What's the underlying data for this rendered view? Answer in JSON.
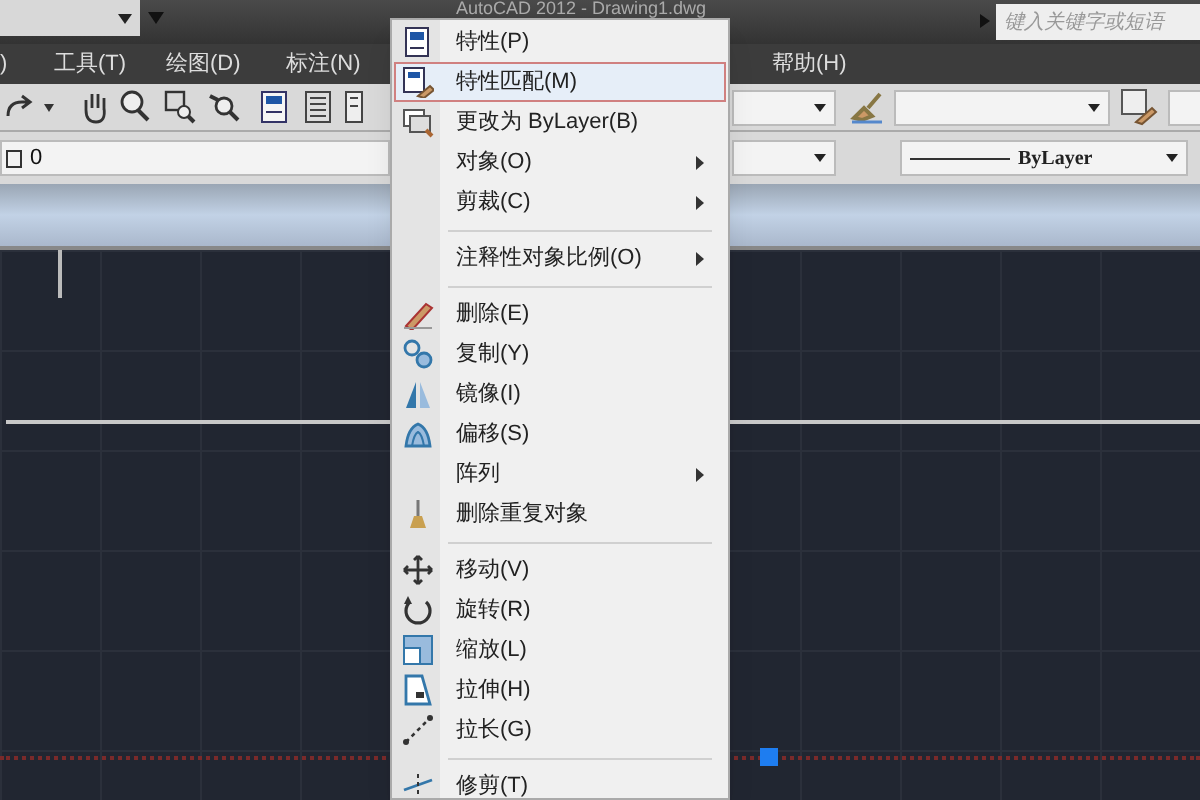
{
  "window": {
    "title": "AutoCAD 2012 - Drawing1.dwg",
    "search_placeholder": "键入关键字或短语"
  },
  "menu_bar": [
    ")",
    "工具(T)",
    "绘图(D)",
    "标注(N)",
    "帮助(H)"
  ],
  "layers_toolbar": {
    "layer": "0",
    "linetype": "ByLayer"
  },
  "context_menu": [
    {
      "kind": "item",
      "label": "特性(P)",
      "selected": false,
      "submenu": false
    },
    {
      "kind": "item",
      "label": "特性匹配(M)",
      "selected": true,
      "submenu": false
    },
    {
      "kind": "item",
      "label": "更改为 ByLayer(B)",
      "selected": false,
      "submenu": false
    },
    {
      "kind": "item",
      "label": "对象(O)",
      "selected": false,
      "submenu": true
    },
    {
      "kind": "item",
      "label": "剪裁(C)",
      "selected": false,
      "submenu": true
    },
    {
      "kind": "separator"
    },
    {
      "kind": "item",
      "label": "注释性对象比例(O)",
      "selected": false,
      "submenu": true
    },
    {
      "kind": "separator"
    },
    {
      "kind": "item",
      "label": "删除(E)",
      "selected": false,
      "submenu": false
    },
    {
      "kind": "item",
      "label": "复制(Y)",
      "selected": false,
      "submenu": false
    },
    {
      "kind": "item",
      "label": "镜像(I)",
      "selected": false,
      "submenu": false
    },
    {
      "kind": "item",
      "label": "偏移(S)",
      "selected": false,
      "submenu": false
    },
    {
      "kind": "item",
      "label": "阵列",
      "selected": false,
      "submenu": true
    },
    {
      "kind": "item",
      "label": "删除重复对象",
      "selected": false,
      "submenu": false
    },
    {
      "kind": "separator"
    },
    {
      "kind": "item",
      "label": "移动(V)",
      "selected": false,
      "submenu": false
    },
    {
      "kind": "item",
      "label": "旋转(R)",
      "selected": false,
      "submenu": false
    },
    {
      "kind": "item",
      "label": "缩放(L)",
      "selected": false,
      "submenu": false
    },
    {
      "kind": "item",
      "label": "拉伸(H)",
      "selected": false,
      "submenu": false
    },
    {
      "kind": "item",
      "label": "拉长(G)",
      "selected": false,
      "submenu": false
    },
    {
      "kind": "separator"
    },
    {
      "kind": "item",
      "label": "修剪(T)",
      "selected": false,
      "submenu": false
    }
  ]
}
